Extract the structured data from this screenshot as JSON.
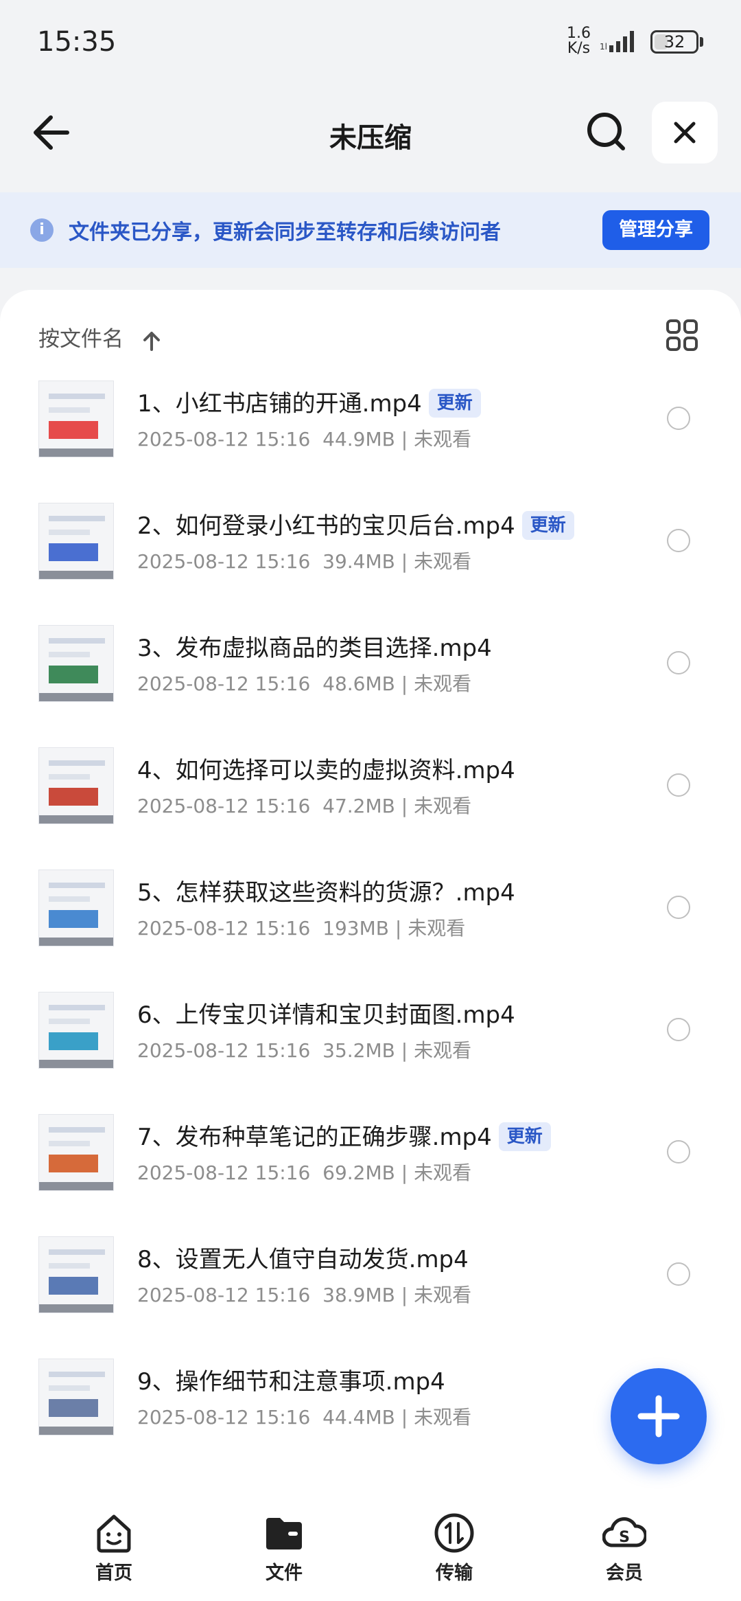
{
  "status_bar": {
    "time": "15:35",
    "net_speed_value": "1.6",
    "net_speed_unit": "K/s",
    "battery": "32",
    "battery_level": 0.32
  },
  "header": {
    "title": "未压缩"
  },
  "share_banner": {
    "text": "文件夹已分享，更新会同步至转存和后续访问者",
    "button": "管理分享"
  },
  "toolbar": {
    "sort_label": "按文件名"
  },
  "files": [
    {
      "name": "1、小红书店铺的开通.mp4",
      "badge": "更新",
      "date": "2025-08-12 15:16",
      "size": "44.9MB",
      "status": "未观看"
    },
    {
      "name": "2、如何登录小红书的宝贝后台.mp4",
      "badge": "更新",
      "date": "2025-08-12 15:16",
      "size": "39.4MB",
      "status": "未观看"
    },
    {
      "name": "3、发布虚拟商品的类目选择.mp4",
      "badge": "",
      "date": "2025-08-12 15:16",
      "size": "48.6MB",
      "status": "未观看"
    },
    {
      "name": "4、如何选择可以卖的虚拟资料.mp4",
      "badge": "",
      "date": "2025-08-12 15:16",
      "size": "47.2MB",
      "status": "未观看"
    },
    {
      "name": "5、怎样获取这些资料的货源？.mp4",
      "badge": "",
      "date": "2025-08-12 15:16",
      "size": "193MB",
      "status": "未观看"
    },
    {
      "name": "6、上传宝贝详情和宝贝封面图.mp4",
      "badge": "",
      "date": "2025-08-12 15:16",
      "size": "35.2MB",
      "status": "未观看"
    },
    {
      "name": "7、发布种草笔记的正确步骤.mp4",
      "badge": "更新",
      "date": "2025-08-12 15:16",
      "size": "69.2MB",
      "status": "未观看"
    },
    {
      "name": "8、设置无人值守自动发货.mp4",
      "badge": "",
      "date": "2025-08-12 15:16",
      "size": "38.9MB",
      "status": "未观看"
    },
    {
      "name": "9、操作细节和注意事项.mp4",
      "badge": "",
      "date": "2025-08-12 15:16",
      "size": "44.4MB",
      "status": "未观看"
    }
  ],
  "bottom_nav": [
    {
      "label": "首页",
      "icon": "home-face-icon"
    },
    {
      "label": "文件",
      "icon": "folder-icon"
    },
    {
      "label": "传输",
      "icon": "transfer-icon"
    },
    {
      "label": "会员",
      "icon": "membership-icon"
    }
  ],
  "colors": {
    "accent": "#1f5ee8",
    "banner_bg": "#e8eefa",
    "badge_text": "#2a57c6"
  }
}
